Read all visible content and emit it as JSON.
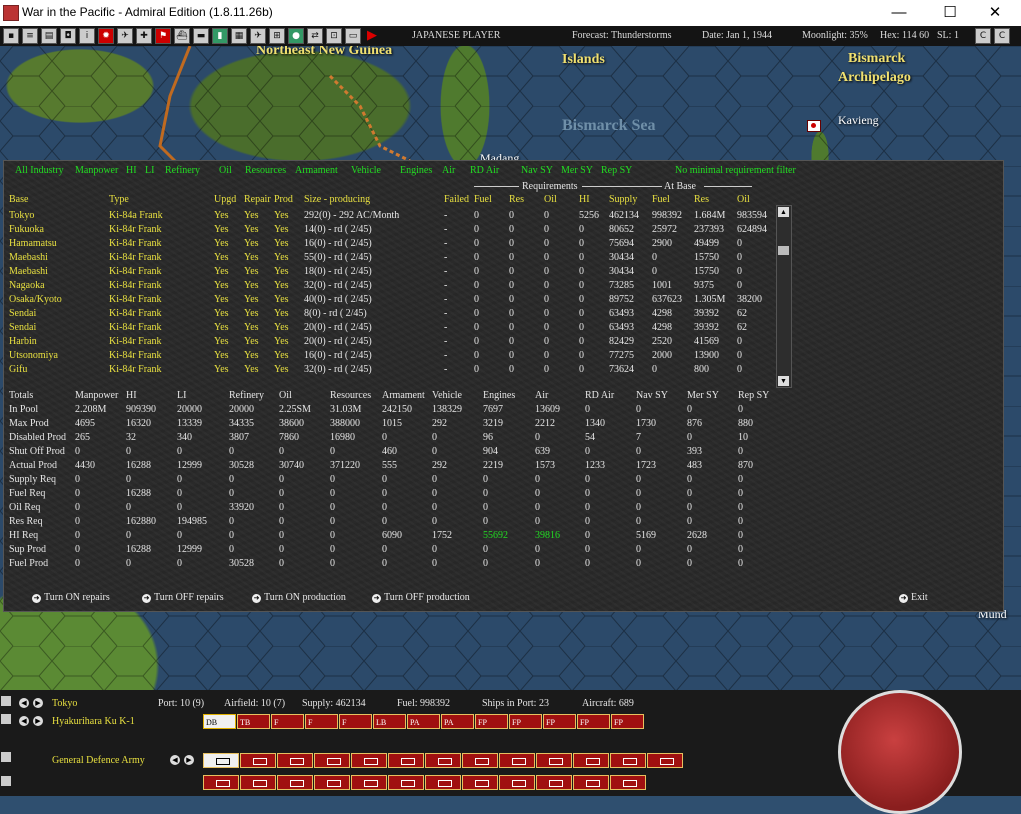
{
  "window": {
    "title": "War in the Pacific - Admiral Edition (1.8.11.26b)",
    "minimize": "—",
    "maximize": "☐",
    "close": "✕"
  },
  "toolbar": {
    "player": "JAPANESE PLAYER",
    "forecast": "Forecast: Thunderstorms",
    "date": "Date: Jan 1, 1944",
    "moonlight": "Moonlight: 35%",
    "hex": "Hex: 114 60",
    "sl": "SL: 1",
    "right_buttons": [
      "C",
      "C"
    ]
  },
  "map": {
    "labels": [
      "Northeast New Guinea",
      "Islands",
      "Bismarck",
      "Archipelago",
      "Bismarck Sea",
      "Kavieng",
      "Madang",
      "Mund"
    ]
  },
  "filters": [
    "All Industry",
    "Manpower",
    "HI",
    "LI",
    "Refinery",
    "Oil",
    "Resources",
    "Armament",
    "Vehicle",
    "Engines",
    "Air",
    "RD Air",
    "Nav SY",
    "Mer SY",
    "Rep SY",
    "No minimal requirement filter"
  ],
  "group_headers": {
    "requirements": "Requirements",
    "at_base": "At Base"
  },
  "base_columns": [
    "Base",
    "Type",
    "Upgd",
    "Repair",
    "Prod",
    "Size - producing",
    "Failed",
    "Fuel",
    "Res",
    "Oil",
    "HI",
    "Supply",
    "Fuel",
    "Res",
    "Oil"
  ],
  "bases": [
    [
      "Tokyo",
      "Ki-84a Frank",
      "Yes",
      "Yes",
      "Yes",
      "292(0) - 292 AC/Month",
      "-",
      "0",
      "0",
      "0",
      "5256",
      "462134",
      "998392",
      "1.684M",
      "983594"
    ],
    [
      "Fukuoka",
      "Ki-84r Frank",
      "Yes",
      "Yes",
      "Yes",
      "14(0) - rd ( 2/45)",
      "-",
      "0",
      "0",
      "0",
      "0",
      "80652",
      "25972",
      "237393",
      "624894"
    ],
    [
      "Hamamatsu",
      "Ki-84r Frank",
      "Yes",
      "Yes",
      "Yes",
      "16(0) - rd ( 2/45)",
      "-",
      "0",
      "0",
      "0",
      "0",
      "75694",
      "2900",
      "49499",
      "0"
    ],
    [
      "Maebashi",
      "Ki-84r Frank",
      "Yes",
      "Yes",
      "Yes",
      "55(0) - rd ( 2/45)",
      "-",
      "0",
      "0",
      "0",
      "0",
      "30434",
      "0",
      "15750",
      "0"
    ],
    [
      "Maebashi",
      "Ki-84r Frank",
      "Yes",
      "Yes",
      "Yes",
      "18(0) - rd ( 2/45)",
      "-",
      "0",
      "0",
      "0",
      "0",
      "30434",
      "0",
      "15750",
      "0"
    ],
    [
      "Nagaoka",
      "Ki-84r Frank",
      "Yes",
      "Yes",
      "Yes",
      "32(0) - rd ( 2/45)",
      "-",
      "0",
      "0",
      "0",
      "0",
      "73285",
      "1001",
      "9375",
      "0"
    ],
    [
      "Osaka/Kyoto",
      "Ki-84r Frank",
      "Yes",
      "Yes",
      "Yes",
      "40(0) - rd ( 2/45)",
      "-",
      "0",
      "0",
      "0",
      "0",
      "89752",
      "637623",
      "1.305M",
      "38200"
    ],
    [
      "Sendai",
      "Ki-84r Frank",
      "Yes",
      "Yes",
      "Yes",
      "8(0) - rd ( 2/45)",
      "-",
      "0",
      "0",
      "0",
      "0",
      "63493",
      "4298",
      "39392",
      "62"
    ],
    [
      "Sendai",
      "Ki-84r Frank",
      "Yes",
      "Yes",
      "Yes",
      "20(0) - rd ( 2/45)",
      "-",
      "0",
      "0",
      "0",
      "0",
      "63493",
      "4298",
      "39392",
      "62"
    ],
    [
      "Harbin",
      "Ki-84r Frank",
      "Yes",
      "Yes",
      "Yes",
      "20(0) - rd ( 2/45)",
      "-",
      "0",
      "0",
      "0",
      "0",
      "82429",
      "2520",
      "41569",
      "0"
    ],
    [
      "Utsonomiya",
      "Ki-84r Frank",
      "Yes",
      "Yes",
      "Yes",
      "16(0) - rd ( 2/45)",
      "-",
      "0",
      "0",
      "0",
      "0",
      "77275",
      "2000",
      "13900",
      "0"
    ],
    [
      "Gifu",
      "Ki-84r Frank",
      "Yes",
      "Yes",
      "Yes",
      "32(0) - rd ( 2/45)",
      "-",
      "0",
      "0",
      "0",
      "0",
      "73624",
      "0",
      "800",
      "0"
    ]
  ],
  "totals_columns": [
    "Totals",
    "Manpower",
    "HI",
    "LI",
    "Refinery",
    "Oil",
    "Resources",
    "Armament",
    "Vehicle",
    "Engines",
    "Air",
    "RD Air",
    "Nav SY",
    "Mer SY",
    "Rep SY"
  ],
  "totals": [
    [
      "In Pool",
      "2.208M",
      "909390",
      "20000",
      "20000",
      "2.25SM",
      "31.03M",
      "242150",
      "138329",
      "7697",
      "13609",
      "0",
      "0",
      "0",
      "0"
    ],
    [
      "Max Prod",
      "4695",
      "16320",
      "13339",
      "34335",
      "38600",
      "388000",
      "1015",
      "292",
      "3219",
      "2212",
      "1340",
      "1730",
      "876",
      "880"
    ],
    [
      "Disabled Prod",
      "265",
      "32",
      "340",
      "3807",
      "7860",
      "16980",
      "0",
      "0",
      "96",
      "0",
      "54",
      "7",
      "0",
      "10"
    ],
    [
      "Shut Off Prod",
      "0",
      "0",
      "0",
      "0",
      "0",
      "0",
      "460",
      "0",
      "904",
      "639",
      "0",
      "0",
      "393",
      "0"
    ],
    [
      "Actual Prod",
      "4430",
      "16288",
      "12999",
      "30528",
      "30740",
      "371220",
      "555",
      "292",
      "2219",
      "1573",
      "1233",
      "1723",
      "483",
      "870"
    ],
    [
      "Supply Req",
      "0",
      "0",
      "0",
      "0",
      "0",
      "0",
      "0",
      "0",
      "0",
      "0",
      "0",
      "0",
      "0",
      "0"
    ],
    [
      "Fuel Req",
      "0",
      "16288",
      "0",
      "0",
      "0",
      "0",
      "0",
      "0",
      "0",
      "0",
      "0",
      "0",
      "0",
      "0"
    ],
    [
      "Oil Req",
      "0",
      "0",
      "0",
      "33920",
      "0",
      "0",
      "0",
      "0",
      "0",
      "0",
      "0",
      "0",
      "0",
      "0"
    ],
    [
      "Res Req",
      "0",
      "162880",
      "194985",
      "0",
      "0",
      "0",
      "0",
      "0",
      "0",
      "0",
      "0",
      "0",
      "0",
      "0"
    ],
    [
      "HI Req",
      "0",
      "0",
      "0",
      "0",
      "0",
      "0",
      "6090",
      "1752",
      "55692",
      "39816",
      "0",
      "5169",
      "2628",
      "0"
    ],
    [
      "Sup Prod",
      "0",
      "16288",
      "12999",
      "0",
      "0",
      "0",
      "0",
      "0",
      "0",
      "0",
      "0",
      "0",
      "0",
      "0"
    ],
    [
      "Fuel Prod",
      "0",
      "0",
      "0",
      "30528",
      "0",
      "0",
      "0",
      "0",
      "0",
      "0",
      "0",
      "0",
      "0",
      "0"
    ]
  ],
  "buttons": {
    "repairs_on": "Turn ON repairs",
    "repairs_off": "Turn OFF repairs",
    "production_on": "Turn ON production",
    "production_off": "Turn OFF production",
    "exit": "Exit"
  },
  "status": {
    "base": "Tokyo",
    "port": "Port: 10 (9)",
    "airfield": "Airfield: 10 (7)",
    "supply": "Supply: 462134",
    "fuel": "Fuel: 998392",
    "ships": "Ships in Port: 23",
    "aircraft": "Aircraft: 689",
    "air_hq": "Hyakurihara Ku K-1",
    "land_hq": "General Defence Army"
  },
  "air_slots": [
    "DB",
    "TB",
    "F",
    "F",
    "F",
    "LB",
    "PA",
    "PA",
    "FP",
    "FP",
    "FP",
    "FP",
    "FP"
  ]
}
